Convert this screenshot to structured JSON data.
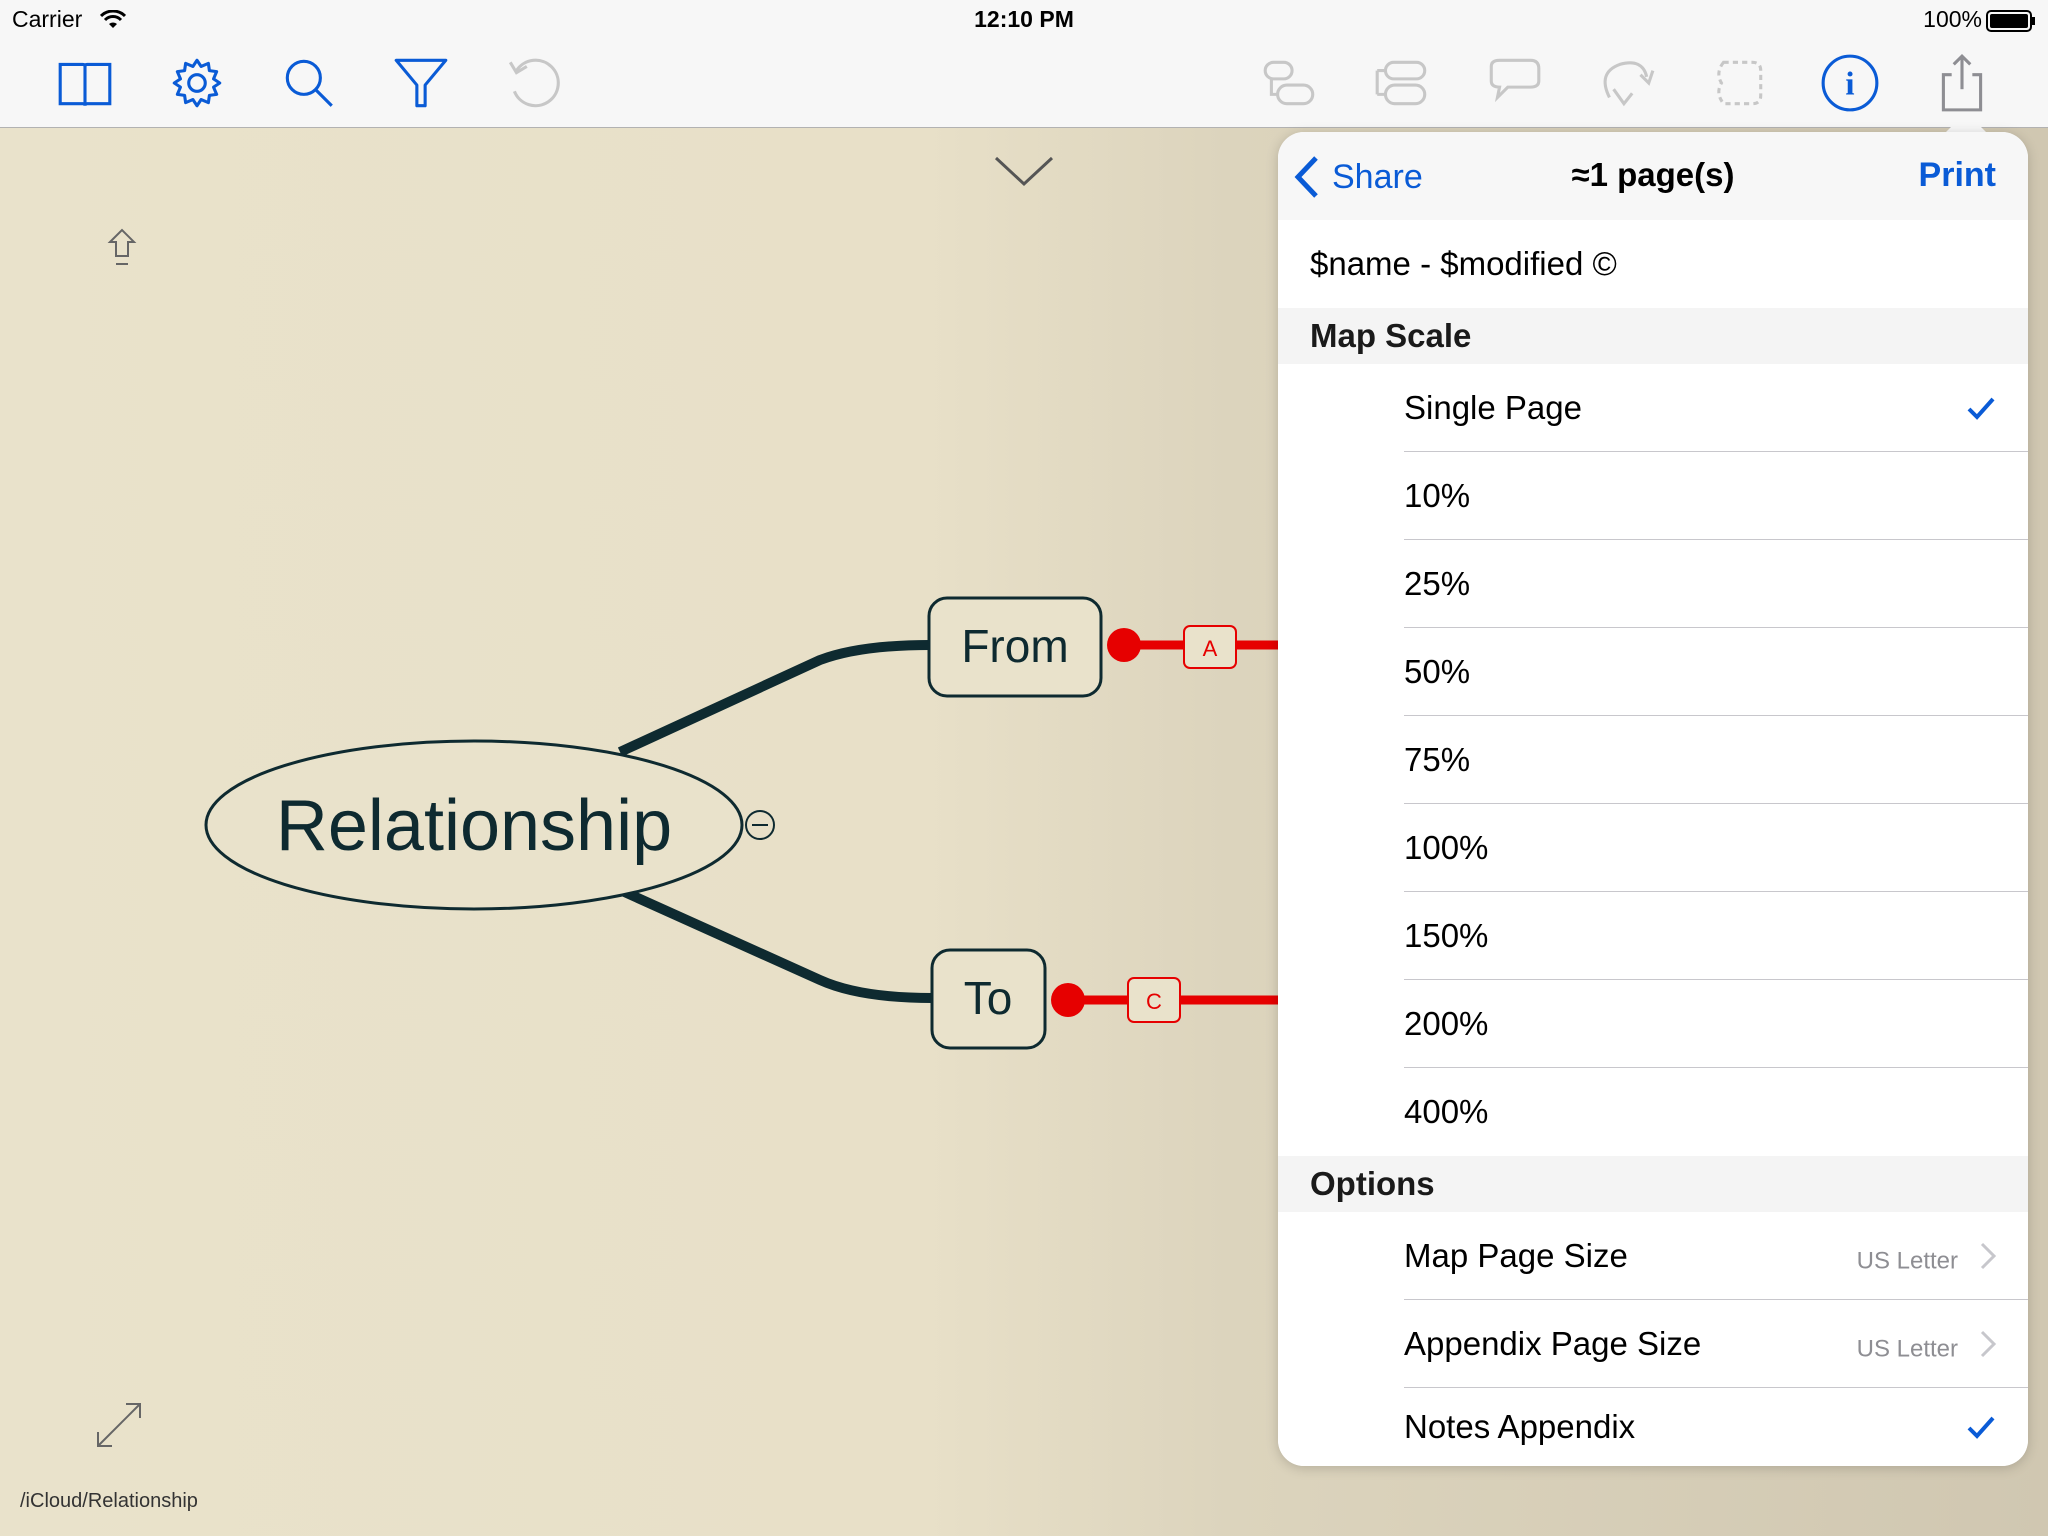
{
  "status_bar": {
    "carrier": "Carrier",
    "time": "12:10 PM",
    "battery": "100%"
  },
  "toolbar": {
    "left_icons": [
      "book-icon",
      "gear-icon",
      "search-icon",
      "filter-icon",
      "undo-icon"
    ],
    "right_icons": [
      "topic-icon",
      "subtopic-icon",
      "callout-icon",
      "relationship-icon",
      "boundary-icon",
      "info-icon",
      "share-icon"
    ]
  },
  "map": {
    "central_topic": "Relationship",
    "topics": [
      "From",
      "To"
    ],
    "labels": [
      "A",
      "C"
    ],
    "collapse_symbol": "⊖"
  },
  "path": "/iCloud/Relationship",
  "popover": {
    "back_label": "Share",
    "title": "≈1 page(s)",
    "print_label": "Print",
    "header_field": "$name - $modified ©",
    "map_scale": {
      "title": "Map Scale",
      "items": [
        {
          "label": "Single Page",
          "checked": true
        },
        {
          "label": "10%",
          "checked": false
        },
        {
          "label": "25%",
          "checked": false
        },
        {
          "label": "50%",
          "checked": false
        },
        {
          "label": "75%",
          "checked": false
        },
        {
          "label": "100%",
          "checked": false
        },
        {
          "label": "150%",
          "checked": false
        },
        {
          "label": "200%",
          "checked": false
        },
        {
          "label": "400%",
          "checked": false
        }
      ]
    },
    "options": {
      "title": "Options",
      "map_page_size": {
        "label": "Map Page Size",
        "value": "US Letter"
      },
      "appendix_page_size": {
        "label": "Appendix Page Size",
        "value": "US Letter"
      },
      "notes_appendix": {
        "label": "Notes Appendix",
        "checked": true
      }
    }
  },
  "colors": {
    "accent": "#0a5bd6",
    "relation": "#e60000",
    "topic_stroke": "#0e2a30"
  }
}
